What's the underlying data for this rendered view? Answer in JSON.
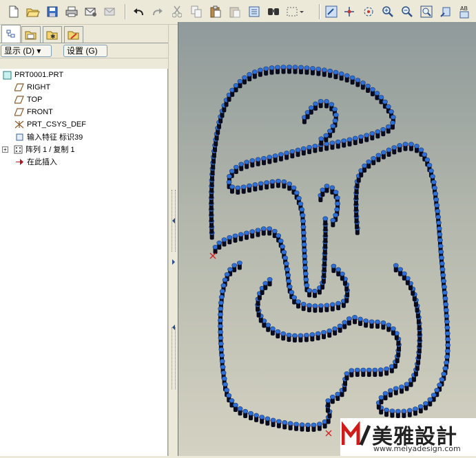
{
  "toolbar": {
    "icons": [
      "new-icon",
      "open-icon",
      "save-icon",
      "print-icon",
      "send-mail-icon",
      "send-mail-disabled-icon",
      "undo-icon",
      "redo-icon",
      "cut-icon",
      "copy-icon",
      "paste-icon",
      "paste-special-icon",
      "regenerate-icon",
      "find-icon",
      "select-box-icon",
      "repaint-icon",
      "spin-center-icon",
      "orient-icon",
      "zoom-in-icon",
      "zoom-out-icon",
      "refit-icon",
      "reorient-icon",
      "annotation-icon"
    ]
  },
  "panel": {
    "tabs": [
      "model-tree-tab",
      "folder-browser-tab",
      "favorites-tab",
      "connections-tab"
    ],
    "show_button": "显示 (D) ▾",
    "settings_button": "设置 (G) ▾",
    "tree": [
      {
        "label": "PRT0001.PRT",
        "icon": "part-icon"
      },
      {
        "label": "RIGHT",
        "icon": "datum-plane-icon"
      },
      {
        "label": "TOP",
        "icon": "datum-plane-icon"
      },
      {
        "label": "FRONT",
        "icon": "datum-plane-icon"
      },
      {
        "label": "PRT_CSYS_DEF",
        "icon": "csys-icon"
      },
      {
        "label": "输入特征 标识39",
        "icon": "import-feature-icon"
      },
      {
        "label": "阵列 1 / 复制 1",
        "icon": "pattern-icon"
      },
      {
        "label": "在此插入",
        "icon": "insert-here-arrow-icon"
      }
    ]
  },
  "viewport": {
    "model": "patterned-chain-outline",
    "link_color": "#2f6fd6",
    "shadow_color": "#0b0b1e"
  },
  "watermark": {
    "brand": "美雅設計",
    "url": "www.meiyadesign.com"
  }
}
